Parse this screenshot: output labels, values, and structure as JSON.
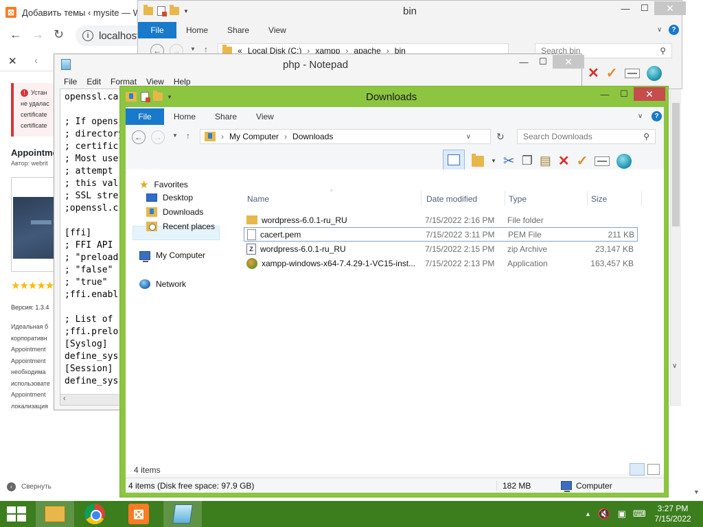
{
  "browser": {
    "tab_title": "Добавить темы ‹ mysite — W",
    "url": "localhost/",
    "error_lines": [
      "Устан",
      "не удалас",
      "certificate",
      "certificate"
    ],
    "theme_title": "Appointme",
    "author": "Автор: webrit",
    "version": "Версия: 1.3.4",
    "description_lines": [
      "Идеальная б",
      "корпоративн",
      "Appointment",
      "Appointment",
      "необходима",
      "использовате",
      "Appointment",
      "локализация"
    ],
    "collapse_label": "Свернуть"
  },
  "bin_window": {
    "title": "bin",
    "ribbon_tabs": [
      "File",
      "Home",
      "Share",
      "View"
    ],
    "path": [
      "Local Disk (C:)",
      "xampp",
      "apache",
      "bin"
    ],
    "search_placeholder": "Search bin"
  },
  "notepad": {
    "title": "php - Notepad",
    "menu": [
      "File",
      "Edit",
      "Format",
      "View",
      "Help"
    ],
    "lines": [
      "openssl.ca",
      "",
      "; If opens",
      "; directory",
      "; certific",
      "; Most use",
      "; attempt",
      "; this val",
      "; SSL stre",
      ";openssl.c",
      "",
      "[ffi]",
      "; FFI API",
      "; \"preload",
      "; \"false\"",
      "; \"true\"",
      ";ffi.enabl",
      "",
      "; List of",
      ";ffi.prelo",
      "[Syslog]",
      "define_sys",
      "[Session]",
      "define_sys"
    ]
  },
  "downloads_window": {
    "title": "Downloads",
    "ribbon_tabs": [
      "File",
      "Home",
      "Share",
      "View"
    ],
    "path": [
      "My Computer",
      "Downloads"
    ],
    "search_placeholder": "Search Downloads",
    "nav": {
      "favorites": "Favorites",
      "desktop": "Desktop",
      "downloads": "Downloads",
      "recent": "Recent places",
      "my_computer": "My Computer",
      "network": "Network"
    },
    "columns": {
      "name": "Name",
      "date": "Date modified",
      "type": "Type",
      "size": "Size"
    },
    "files": [
      {
        "name": "wordpress-6.0.1-ru_RU",
        "date": "7/15/2022 2:16 PM",
        "type": "File folder",
        "size": "",
        "icon": "folder-icon"
      },
      {
        "name": "cacert.pem",
        "date": "7/15/2022 3:11 PM",
        "type": "PEM File",
        "size": "211 KB",
        "icon": "document-icon"
      },
      {
        "name": "wordpress-6.0.1-ru_RU",
        "date": "7/15/2022 2:15 PM",
        "type": "zip Archive",
        "size": "23,147 KB",
        "icon": "zip-icon"
      },
      {
        "name": "xampp-windows-x64-7.4.29-1-VC15-inst...",
        "date": "7/15/2022 2:13 PM",
        "type": "Application",
        "size": "163,457 KB",
        "icon": "app-icon"
      }
    ],
    "item_count": "4 items",
    "status": {
      "info": "4 items (Disk free space: 97.9 GB)",
      "size": "182 MB",
      "location": "Computer"
    }
  },
  "taskbar": {
    "time": "3:27 PM",
    "date": "7/15/2022"
  },
  "colors": {
    "active_frame": "#8cc540",
    "taskbar": "#3c7d1e",
    "ribbon_file": "#1979ca",
    "close_active": "#c74c4c"
  }
}
